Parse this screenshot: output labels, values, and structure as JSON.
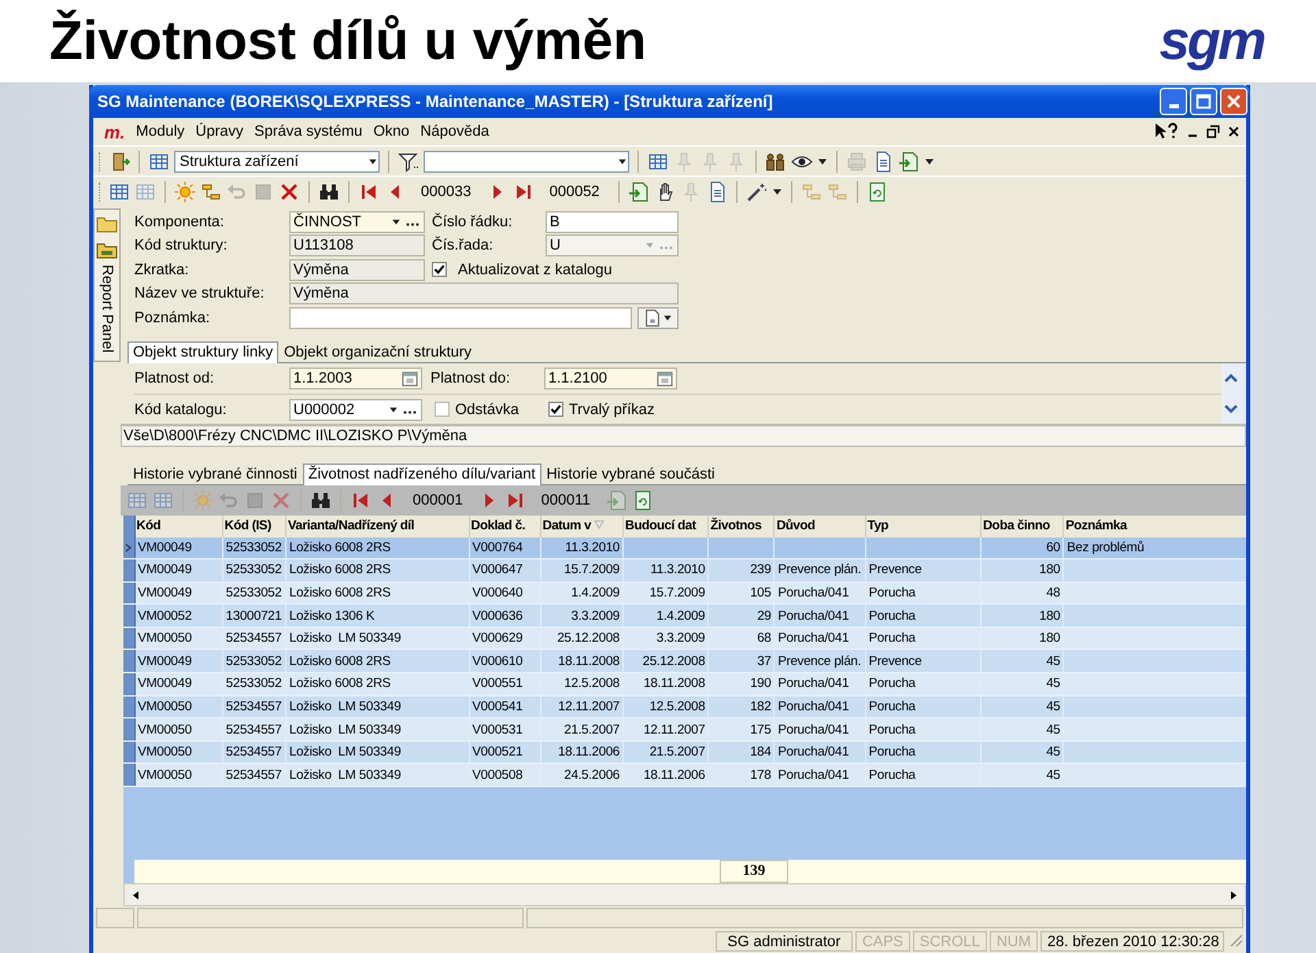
{
  "header": {
    "title": "Životnost dílů u výměn",
    "logo": "sgm"
  },
  "window": {
    "title": "SG Maintenance (BOREK\\SQLEXPRESS - Maintenance_MASTER) - [Struktura zařízení]"
  },
  "menu": {
    "app_logo": "m.",
    "items": [
      "Moduly",
      "Úpravy",
      "Správa systému",
      "Okno",
      "Nápověda"
    ]
  },
  "toolbar": {
    "view_select": "Struktura zařízení",
    "record_current": "000033",
    "record_total": "000052"
  },
  "side_panel": {
    "label": "Report Panel"
  },
  "form": {
    "component": {
      "label": "Komponenta:",
      "value": "ČINNOST",
      "kind": "lookup"
    },
    "structure_code": {
      "label": "Kód struktury:",
      "value": "U113108",
      "kind": "readonly"
    },
    "abbreviation": {
      "label": "Zkratka:",
      "value": "Výměna",
      "kind": "readonly"
    },
    "structure_name": {
      "label": "Název ve struktuře:",
      "value": "Výměna",
      "kind": "readonly"
    },
    "note": {
      "label": "Poznámka:",
      "kind": "text"
    },
    "row_number": {
      "label": "Číslo řádku:",
      "value": "B",
      "kind": "text"
    },
    "series": {
      "label": "Čís.řada:",
      "value": "U",
      "kind": "lookup_disabled"
    },
    "update_from_catalog": {
      "label": "Aktualizovat z katalogu",
      "checked": true
    }
  },
  "form_tabs": [
    {
      "label": "Objekt struktury linky",
      "selected": true
    },
    {
      "label": "Objekt organizační struktury",
      "selected": false
    }
  ],
  "tab_content": {
    "valid_from": {
      "label": "Platnost od:",
      "value": "1.1.2003"
    },
    "valid_to": {
      "label": "Platnost do:",
      "value": "1.1.2100"
    },
    "catalog_code": {
      "label": "Kód katalogu:",
      "value": "U000002"
    },
    "outage": {
      "label": "Odstávka",
      "checked": false
    },
    "permanent_order": {
      "label": "Trvalý příkaz",
      "checked": true
    }
  },
  "path": "Vše\\D\\800\\Frézy CNC\\DMC II\\LOZISKO P\\Výměna",
  "grid_tabs": [
    {
      "label": "Historie vybrané činnosti",
      "selected": false
    },
    {
      "label": "Životnost nadřízeného dílu/variant",
      "selected": true
    },
    {
      "label": "Historie vybrané součásti",
      "selected": false
    }
  ],
  "grid_toolbar": {
    "record_current": "000001",
    "record_total": "000011"
  },
  "grid": {
    "columns": [
      {
        "label": "Kód",
        "sorted": false
      },
      {
        "label": "Kód (IS)",
        "sorted": false
      },
      {
        "label": "Varianta/Nadřízený díl",
        "sorted": false
      },
      {
        "label": "Doklad č.",
        "sorted": false
      },
      {
        "label": "Datum v",
        "sorted": true
      },
      {
        "label": "Budoucí dat",
        "sorted": false
      },
      {
        "label": "Životnos",
        "sorted": false
      },
      {
        "label": "Důvod",
        "sorted": false
      },
      {
        "label": "Typ",
        "sorted": false
      },
      {
        "label": "Doba činno",
        "sorted": false
      },
      {
        "label": "Poznámka",
        "sorted": false
      }
    ],
    "rows": [
      {
        "selected": true,
        "cells": [
          "VM00049",
          "52533052",
          "Ložisko 6008 2RS",
          "V000764",
          "11.3.2010",
          null,
          null,
          null,
          null,
          "60",
          "Bez problémů"
        ]
      },
      {
        "selected": false,
        "cells": [
          "VM00049",
          "52533052",
          "Ložisko 6008 2RS",
          "V000647",
          "15.7.2009",
          "11.3.2010",
          "239",
          "Prevence plán.",
          "Prevence",
          "180",
          null
        ]
      },
      {
        "selected": false,
        "cells": [
          "VM00049",
          "52533052",
          "Ložisko 6008 2RS",
          "V000640",
          "1.4.2009",
          "15.7.2009",
          "105",
          "Porucha/041",
          "Porucha",
          "48",
          null
        ]
      },
      {
        "selected": false,
        "cells": [
          "VM00052",
          "13000721",
          "Ložisko 1306 K",
          "V000636",
          "3.3.2009",
          "1.4.2009",
          "29",
          "Porucha/041",
          "Porucha",
          "180",
          null
        ]
      },
      {
        "selected": false,
        "cells": [
          "VM00050",
          "52534557",
          "Ložisko  LM 503349",
          "V000629",
          "25.12.2008",
          "3.3.2009",
          "68",
          "Porucha/041",
          "Porucha",
          "180",
          null
        ]
      },
      {
        "selected": false,
        "cells": [
          "VM00049",
          "52533052",
          "Ložisko 6008 2RS",
          "V000610",
          "18.11.2008",
          "25.12.2008",
          "37",
          "Prevence plán.",
          "Prevence",
          "45",
          null
        ]
      },
      {
        "selected": false,
        "cells": [
          "VM00049",
          "52533052",
          "Ložisko 6008 2RS",
          "V000551",
          "12.5.2008",
          "18.11.2008",
          "190",
          "Porucha/041",
          "Porucha",
          "45",
          null
        ]
      },
      {
        "selected": false,
        "cells": [
          "VM00050",
          "52534557",
          "Ložisko  LM 503349",
          "V000541",
          "12.11.2007",
          "12.5.2008",
          "182",
          "Porucha/041",
          "Porucha",
          "45",
          null
        ]
      },
      {
        "selected": false,
        "cells": [
          "VM00050",
          "52534557",
          "Ložisko  LM 503349",
          "V000531",
          "21.5.2007",
          "12.11.2007",
          "175",
          "Porucha/041",
          "Porucha",
          "45",
          null
        ]
      },
      {
        "selected": false,
        "cells": [
          "VM00050",
          "52534557",
          "Ložisko  LM 503349",
          "V000521",
          "18.11.2006",
          "21.5.2007",
          "184",
          "Porucha/041",
          "Porucha",
          "45",
          null
        ]
      },
      {
        "selected": false,
        "cells": [
          "VM00050",
          "52534557",
          "Ložisko  LM 503349",
          "V000508",
          "24.5.2006",
          "18.11.2006",
          "178",
          "Porucha/041",
          "Porucha",
          "45",
          null
        ]
      }
    ],
    "total": "139"
  },
  "status_bar": {
    "user": "SG administrator",
    "indicators": [
      {
        "label": "CAPS",
        "on": false
      },
      {
        "label": "SCROLL",
        "on": false
      },
      {
        "label": "NUM",
        "on": false
      }
    ],
    "datetime": "28. březen 2010 12:30:28"
  }
}
